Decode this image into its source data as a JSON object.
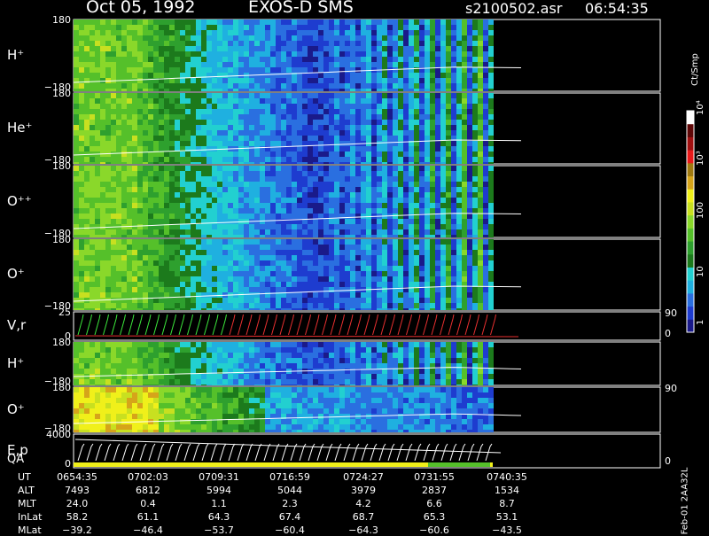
{
  "header": {
    "date": "Oct 05, 1992",
    "instrument": "EXOS-D SMS",
    "filename": "s2100502.asr",
    "time": "06:54:35"
  },
  "colors": {
    "scale": [
      "#1a1a8a",
      "#1e3ccf",
      "#2a6fe0",
      "#1fb0e0",
      "#22d0d0",
      "#1c7a1c",
      "#2ea02e",
      "#55c02a",
      "#8ad82a",
      "#c8e020",
      "#f0f01a",
      "#d6a41a",
      "#a07a10",
      "#e81a1a",
      "#a01010",
      "#600808",
      "#ffffff"
    ]
  },
  "colorbar": {
    "unit": "Ct/Smp",
    "ticks": [
      "1",
      "10",
      "100",
      "10³",
      "10⁴"
    ]
  },
  "panels": [
    {
      "label": "H⁺",
      "ymax": "180",
      "ymin": "−180"
    },
    {
      "label": "He⁺",
      "ymax": "180",
      "ymin": "−180"
    },
    {
      "label": "O⁺⁺",
      "ymax": "180",
      "ymin": "−180"
    },
    {
      "label": "O⁺",
      "ymax": "180",
      "ymin": "−180"
    },
    {
      "label": "V,r",
      "ymax": "25",
      "ymin": "0",
      "right_top": "90",
      "right_bot": "0"
    },
    {
      "label": "H⁺",
      "ymax": "180",
      "ymin": "−180"
    },
    {
      "label": "O⁺",
      "ymax": "180",
      "ymin": "−180",
      "right_top": "90"
    },
    {
      "label": "E,p",
      "label2": "QA",
      "ymax": "4000",
      "ymin": "0",
      "right_bot": "0"
    }
  ],
  "side_label": "Feb-01 2AA32L",
  "chart_data": {
    "type": "heatmap",
    "title": "Oct 05, 1992   EXOS-D SMS",
    "x_label": "UT",
    "ephemeris": {
      "rows": [
        "UT",
        "ALT",
        "MLT",
        "InLat",
        "MLat"
      ],
      "columns": [
        {
          "UT": "0654:35",
          "ALT": "7493",
          "MLT": "24.0",
          "InLat": "58.2",
          "MLat": "−39.2"
        },
        {
          "UT": "0702:03",
          "ALT": "6812",
          "MLT": "0.4",
          "InLat": "61.1",
          "MLat": "−46.4"
        },
        {
          "UT": "0709:31",
          "ALT": "5994",
          "MLT": "1.1",
          "InLat": "64.3",
          "MLat": "−53.7"
        },
        {
          "UT": "0716:59",
          "ALT": "5044",
          "MLT": "2.3",
          "InLat": "67.4",
          "MLat": "−60.4"
        },
        {
          "UT": "0724:27",
          "ALT": "3979",
          "MLT": "4.2",
          "InLat": "68.7",
          "MLat": "−64.3"
        },
        {
          "UT": "0731:55",
          "ALT": "2837",
          "MLT": "6.6",
          "InLat": "65.3",
          "MLat": "−60.6"
        },
        {
          "UT": "0740:35",
          "ALT": "1534",
          "MLT": "8.7",
          "InLat": "53.1",
          "MLat": "−43.5"
        }
      ]
    }
  }
}
